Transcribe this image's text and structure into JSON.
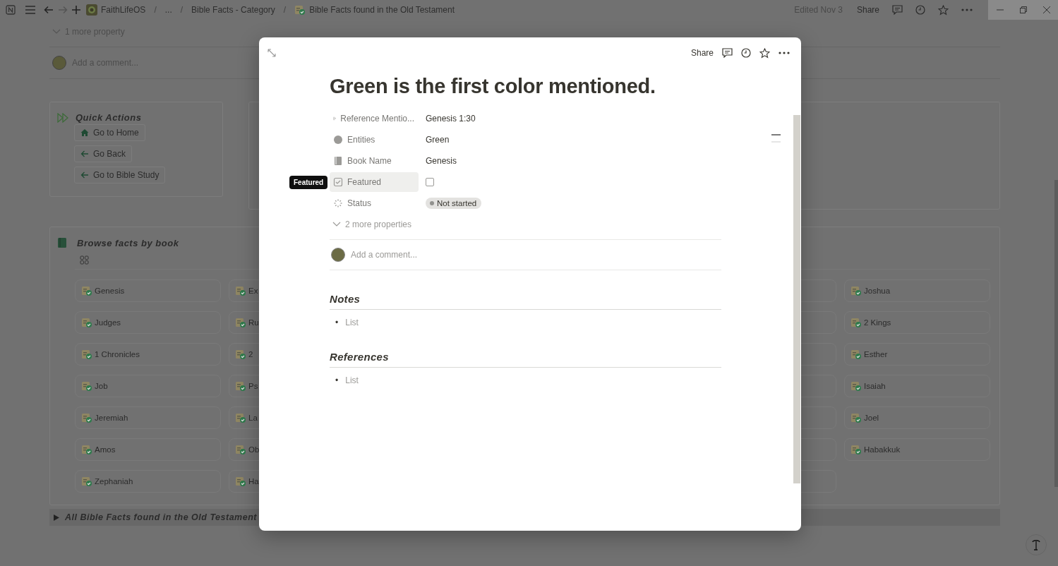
{
  "topbar": {
    "breadcrumbs": [
      {
        "label": "FaithLifeOS",
        "kind": "workspace"
      },
      {
        "label": "...",
        "kind": "plain"
      },
      {
        "label": "Bible Facts - Category",
        "kind": "plain"
      },
      {
        "label": "Bible Facts found in the Old Testament",
        "kind": "page"
      }
    ],
    "separator": "/",
    "edited": "Edited Nov 3",
    "share": "Share"
  },
  "page": {
    "more_property": "1 more property",
    "comment_placeholder": "Add a comment...",
    "quick_actions": {
      "title": "Quick Actions",
      "buttons": [
        {
          "label": "Go to Home",
          "kind": "home"
        },
        {
          "label": "Go Back",
          "kind": "back"
        },
        {
          "label": "Go to Bible Study",
          "kind": "back"
        }
      ]
    },
    "browse": {
      "title": "Browse facts by book",
      "rows": [
        {
          "first": "Genesis",
          "second": "Ex",
          "last": "Joshua"
        },
        {
          "first": "Judges",
          "second": "Ru",
          "last": "2 Kings"
        },
        {
          "first": "1 Chronicles",
          "second": "2",
          "last": "Esther"
        },
        {
          "first": "Job",
          "second": "Ps",
          "last": "Isaiah"
        },
        {
          "first": "Jeremiah",
          "second": "La",
          "last": "Joel"
        },
        {
          "first": "Amos",
          "second": "Ob",
          "last": "Habakkuk"
        },
        {
          "first": "Zephaniah",
          "second": "Ha"
        }
      ]
    },
    "toggle": "All Bible Facts found in the Old Testament"
  },
  "modal": {
    "share": "Share",
    "title": "Green is the first color mentioned.",
    "tooltip": "Featured",
    "properties": [
      {
        "kind": "text",
        "label": "Reference Mentio...",
        "value": "Genesis 1:30",
        "highlighted": false
      },
      {
        "kind": "text",
        "label": "Entities",
        "value": "Green",
        "highlighted": false
      },
      {
        "kind": "text",
        "label": "Book Name",
        "value": "Genesis",
        "highlighted": false
      },
      {
        "kind": "checkbox",
        "label": "Featured",
        "checked": false,
        "highlighted": true
      },
      {
        "kind": "status",
        "label": "Status",
        "value": "Not started",
        "highlighted": false
      }
    ],
    "more": "2 more properties",
    "comment_placeholder": "Add a comment...",
    "sections": [
      {
        "heading": "Notes",
        "items": [
          {
            "bullet": "•",
            "text": "List"
          }
        ]
      },
      {
        "heading": "References",
        "items": [
          {
            "bullet": "•",
            "text": "List"
          }
        ]
      }
    ]
  }
}
